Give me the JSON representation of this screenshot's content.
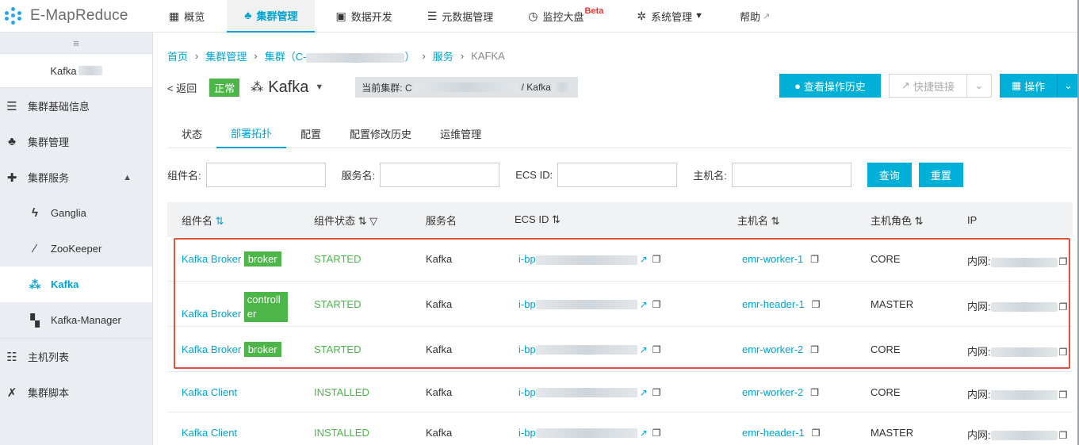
{
  "topnav": {
    "brand": "E-MapReduce",
    "items": [
      {
        "icon": "grid-icon",
        "glyph": "▦",
        "label": "概览",
        "active": false
      },
      {
        "icon": "cluster-icon",
        "glyph": "♣",
        "label": "集群管理",
        "active": true
      },
      {
        "icon": "code-icon",
        "glyph": "▣",
        "label": "数据开发",
        "active": false
      },
      {
        "icon": "database-icon",
        "glyph": "☰",
        "label": "元数据管理",
        "active": false
      },
      {
        "icon": "monitor-icon",
        "glyph": "◷",
        "label": "监控大盘",
        "active": false,
        "badge": "Beta"
      },
      {
        "icon": "gear-icon",
        "glyph": "✲",
        "label": "系统管理",
        "active": false,
        "dropdown": true
      },
      {
        "icon": "external-link-icon",
        "glyph": "↗",
        "label": "帮助",
        "active": false
      }
    ]
  },
  "sidebar": {
    "collapse": "≡",
    "cluster_name": "Kafka",
    "items": [
      {
        "id": "cluster-info",
        "icon": "info-icon",
        "glyph": "☰",
        "label": "集群基础信息",
        "sub": false
      },
      {
        "id": "cluster-manage",
        "icon": "cluster-icon",
        "glyph": "♣",
        "label": "集群管理",
        "sub": false
      },
      {
        "id": "cluster-services",
        "icon": "puzzle-icon",
        "glyph": "✚",
        "label": "集群服务",
        "sub": false,
        "expanded": true
      },
      {
        "id": "ganglia",
        "icon": "lightning-icon",
        "glyph": "ϟ",
        "label": "Ganglia",
        "sub": true
      },
      {
        "id": "zookeeper",
        "icon": "zookeeper-icon",
        "glyph": "⁄",
        "label": "ZooKeeper",
        "sub": true
      },
      {
        "id": "kafka",
        "icon": "kafka-icon",
        "glyph": "⁂",
        "label": "Kafka",
        "sub": true,
        "active": true
      },
      {
        "id": "kafka-manager",
        "icon": "kafka-manager-icon",
        "glyph": "▚",
        "label": "Kafka-Manager",
        "sub": true
      },
      {
        "id": "host-list",
        "icon": "server-icon",
        "glyph": "☷",
        "label": "主机列表",
        "sub": false
      },
      {
        "id": "cluster-scripts",
        "icon": "tools-icon",
        "glyph": "✗",
        "label": "集群脚本",
        "sub": false
      }
    ]
  },
  "breadcrumb": {
    "home": "首页",
    "cluster_manage": "集群管理",
    "cluster_prefix": "集群（C-",
    "cluster_suffix": "）",
    "services": "服务",
    "current": "KAFKA"
  },
  "header": {
    "back": "< 返回",
    "status": "正常",
    "service": "Kafka",
    "current_cluster_prefix": "当前集群: C",
    "current_cluster_mid": "/ Kafka",
    "btn_history": "查看操作历史",
    "btn_quicklink": "快捷链接",
    "btn_operations": "操作"
  },
  "tabs": [
    "状态",
    "部署拓扑",
    "配置",
    "配置修改历史",
    "运维管理"
  ],
  "active_tab": 1,
  "filters": {
    "component_label": "组件名:",
    "service_label": "服务名:",
    "ecs_label": "ECS ID:",
    "host_label": "主机名:",
    "query": "查询",
    "reset": "重置"
  },
  "table": {
    "columns": [
      "组件名",
      "组件状态",
      "服务名",
      "ECS ID",
      "主机名",
      "主机角色",
      "IP"
    ],
    "rows": [
      {
        "component": "Kafka Broker",
        "tag": "broker",
        "status": "STARTED",
        "service": "Kafka",
        "ecs": "i-bp",
        "host": "emr-worker-1",
        "role": "CORE",
        "ip": "内网:"
      },
      {
        "component": "Kafka Broker",
        "tag": "controller",
        "status": "STARTED",
        "service": "Kafka",
        "ecs": "i-bp",
        "host": "emr-header-1",
        "role": "MASTER",
        "ip": "内网:"
      },
      {
        "component": "Kafka Broker",
        "tag": "broker",
        "status": "STARTED",
        "service": "Kafka",
        "ecs": "i-bp",
        "host": "emr-worker-2",
        "role": "CORE",
        "ip": "内网:"
      },
      {
        "component": "Kafka Client",
        "tag": "",
        "status": "INSTALLED",
        "service": "Kafka",
        "ecs": "i-bp",
        "host": "emr-worker-2",
        "role": "CORE",
        "ip": "内网:"
      },
      {
        "component": "Kafka Client",
        "tag": "",
        "status": "INSTALLED",
        "service": "Kafka",
        "ecs": "i-bp",
        "host": "emr-header-1",
        "role": "MASTER",
        "ip": "内网:"
      }
    ]
  },
  "colors": {
    "accent": "#00a3d3",
    "success": "#4cb648",
    "highlight": "#e4523a"
  }
}
